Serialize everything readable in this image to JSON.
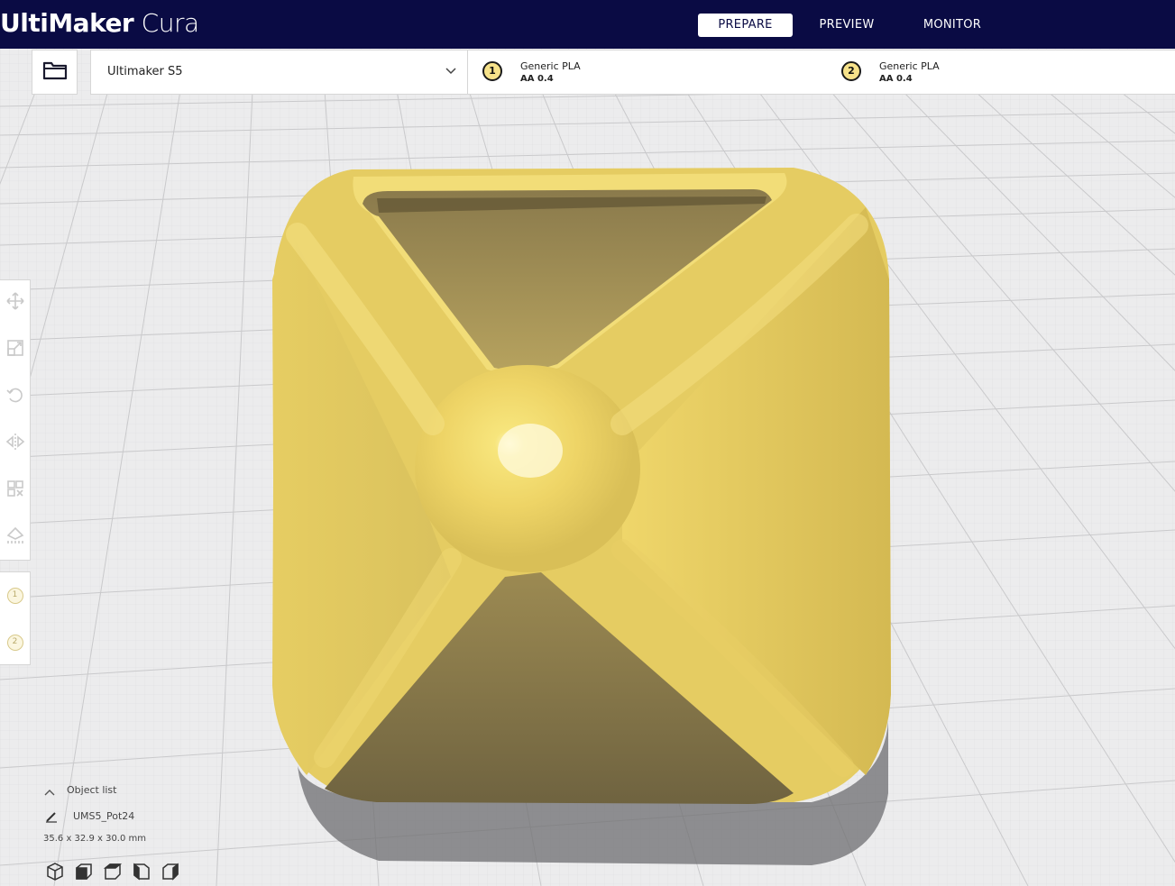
{
  "app": {
    "logo_bold": "UltiMaker",
    "logo_light": " Cura"
  },
  "stages": [
    {
      "label": "PREPARE",
      "active": true
    },
    {
      "label": "PREVIEW",
      "active": false
    },
    {
      "label": "MONITOR",
      "active": false
    }
  ],
  "printer": {
    "name": "Ultimaker S5"
  },
  "extruders": [
    {
      "number": "1",
      "material": "Generic PLA",
      "nozzle": "AA 0.4"
    },
    {
      "number": "2",
      "material": "Generic PLA",
      "nozzle": "AA 0.4"
    }
  ],
  "tools": [
    {
      "icon": "move-icon"
    },
    {
      "icon": "scale-icon"
    },
    {
      "icon": "rotate-icon"
    },
    {
      "icon": "mirror-icon"
    },
    {
      "icon": "per-model-settings-icon"
    },
    {
      "icon": "support-blocker-icon"
    }
  ],
  "side_extruders": [
    "1",
    "2"
  ],
  "object_list": {
    "header": "Object list",
    "object_name": "UMS5_Pot24",
    "dimensions": "35.6 x 32.9 x 30.0 mm"
  },
  "view_buttons": [
    {
      "icon": "3d-view-icon"
    },
    {
      "icon": "front-view-icon"
    },
    {
      "icon": "top-view-icon"
    },
    {
      "icon": "left-view-icon"
    },
    {
      "icon": "right-view-icon"
    }
  ],
  "colors": {
    "header_bg": "#0a0b44",
    "model_yellow": "#f2da6a",
    "model_shadow": "#7f7048",
    "buildplate": "#ececec",
    "grid_line": "#c8c8ca"
  }
}
